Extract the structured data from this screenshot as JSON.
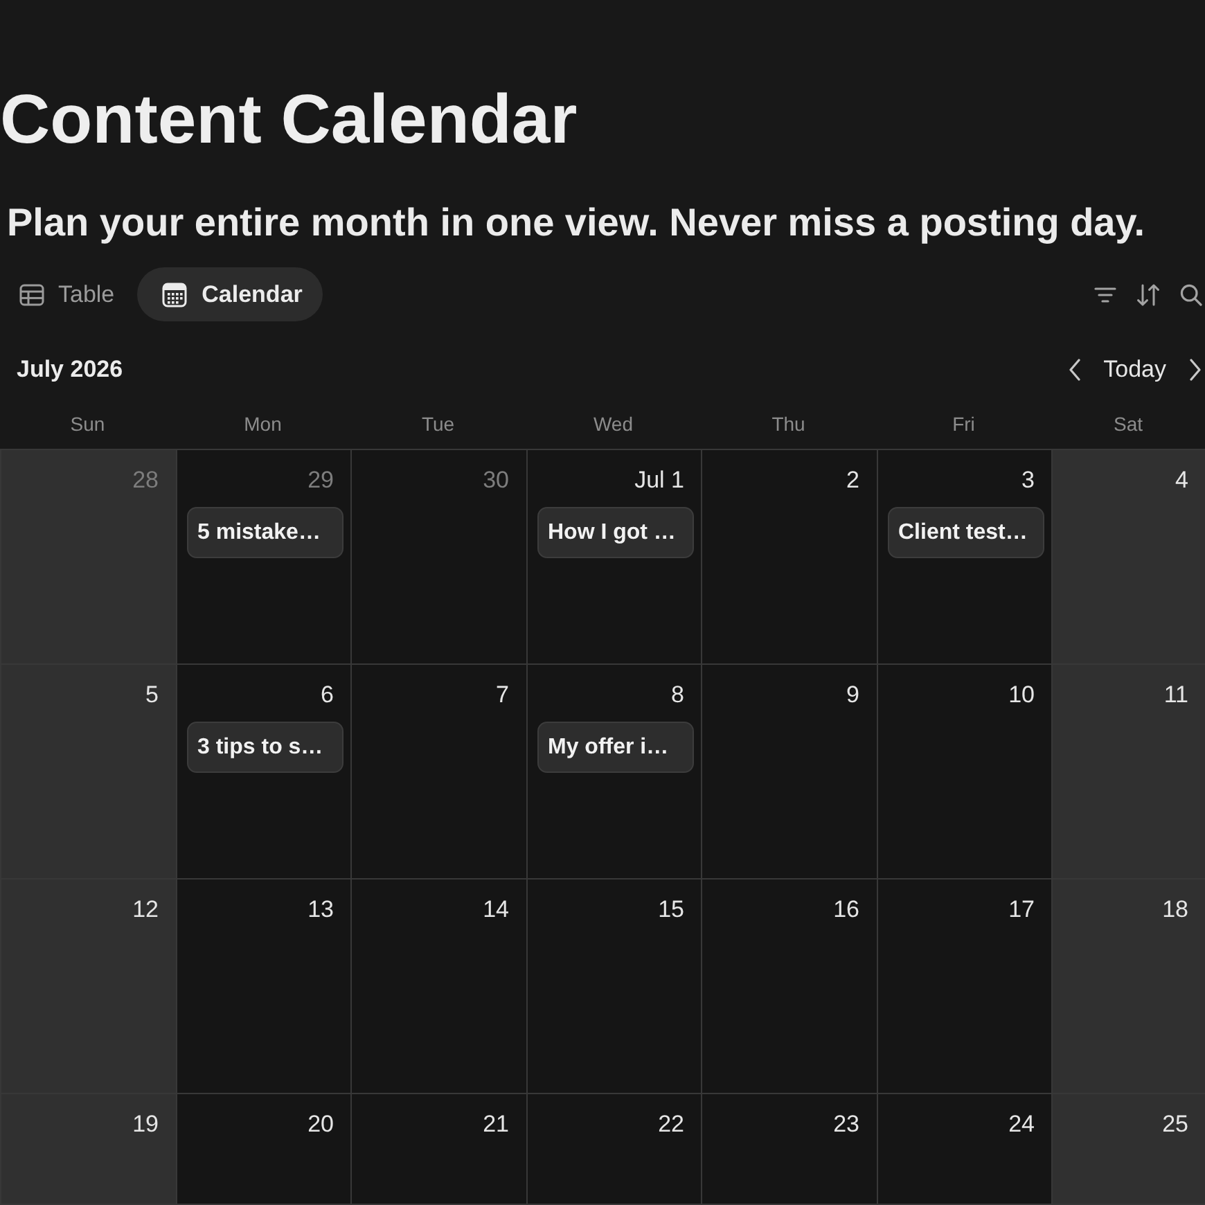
{
  "page": {
    "title": "Content Calendar",
    "subtitle": "Plan your entire month in one view. Never miss a posting day."
  },
  "view_tabs": [
    {
      "label": "Table",
      "kind": "table",
      "selected": false
    },
    {
      "label": "Calendar",
      "kind": "calendar",
      "selected": true
    }
  ],
  "calendar": {
    "month": "July 2026",
    "today_button": "Today",
    "weekdays": [
      {
        "label": "Sun",
        "weekend": true
      },
      {
        "label": "Mon",
        "weekend": false
      },
      {
        "label": "Tue",
        "weekend": false
      },
      {
        "label": "Wed",
        "weekend": false
      },
      {
        "label": "Thu",
        "weekend": false
      },
      {
        "label": "Fri",
        "weekend": false
      },
      {
        "label": "Sat",
        "weekend": true
      }
    ],
    "weeks": [
      {
        "days": [
          {
            "date": "28",
            "in_month": false
          },
          {
            "date": "29",
            "in_month": false,
            "events": [
              {
                "title": "5 mistake…"
              }
            ]
          },
          {
            "date": "30",
            "in_month": false
          },
          {
            "date": "Jul 1",
            "in_month": true,
            "events": [
              {
                "title": "How I got …"
              }
            ]
          },
          {
            "date": "2",
            "in_month": true
          },
          {
            "date": "3",
            "in_month": true,
            "events": [
              {
                "title": "Client test…"
              }
            ]
          },
          {
            "date": "4",
            "in_month": true
          }
        ]
      },
      {
        "days": [
          {
            "date": "5",
            "in_month": true
          },
          {
            "date": "6",
            "in_month": true,
            "events": [
              {
                "title": "3 tips to s…"
              }
            ]
          },
          {
            "date": "7",
            "in_month": true
          },
          {
            "date": "8",
            "in_month": true,
            "events": [
              {
                "title": "My offer i…"
              }
            ]
          },
          {
            "date": "9",
            "in_month": true
          },
          {
            "date": "10",
            "in_month": true
          },
          {
            "date": "11",
            "in_month": true
          }
        ]
      },
      {
        "days": [
          {
            "date": "12",
            "in_month": true
          },
          {
            "date": "13",
            "in_month": true
          },
          {
            "date": "14",
            "in_month": true
          },
          {
            "date": "15",
            "in_month": true
          },
          {
            "date": "16",
            "in_month": true
          },
          {
            "date": "17",
            "in_month": true
          },
          {
            "date": "18",
            "in_month": true
          }
        ]
      },
      {
        "days": [
          {
            "date": "19",
            "in_month": true
          },
          {
            "date": "20",
            "in_month": true
          },
          {
            "date": "21",
            "in_month": true
          },
          {
            "date": "22",
            "in_month": true
          },
          {
            "date": "23",
            "in_month": true
          },
          {
            "date": "24",
            "in_month": true
          },
          {
            "date": "25",
            "in_month": true
          }
        ]
      }
    ]
  }
}
